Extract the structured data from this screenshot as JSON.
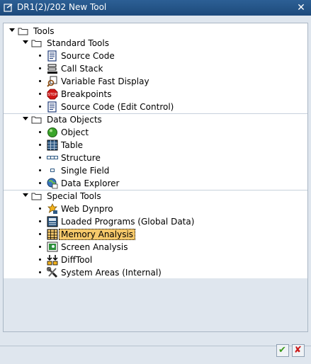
{
  "window": {
    "title": "DR1(2)/202 New Tool",
    "close_glyph": "✕"
  },
  "tree": {
    "root": {
      "label": "Tools",
      "icon": "folder-icon"
    },
    "groups": [
      {
        "label": "Standard Tools",
        "items": [
          {
            "label": "Source Code",
            "icon": "source-code-icon"
          },
          {
            "label": "Call Stack",
            "icon": "call-stack-icon"
          },
          {
            "label": "Variable Fast Display",
            "icon": "variable-display-icon"
          },
          {
            "label": "Breakpoints",
            "icon": "stop-sign-icon",
            "icon_text": "STOP"
          },
          {
            "label": "Source Code (Edit Control)",
            "icon": "source-code-edit-icon"
          }
        ]
      },
      {
        "label": "Data Objects",
        "items": [
          {
            "label": "Object",
            "icon": "object-sphere-icon"
          },
          {
            "label": "Table",
            "icon": "table-icon"
          },
          {
            "label": "Structure",
            "icon": "structure-icon"
          },
          {
            "label": "Single Field",
            "icon": "single-field-icon"
          },
          {
            "label": "Data Explorer",
            "icon": "data-explorer-icon"
          }
        ]
      },
      {
        "label": "Special Tools",
        "items": [
          {
            "label": "Web Dynpro",
            "icon": "web-dynpro-icon"
          },
          {
            "label": "Loaded Programs (Global Data)",
            "icon": "loaded-programs-icon"
          },
          {
            "label": "Memory Analysis",
            "icon": "memory-analysis-icon",
            "selected": true
          },
          {
            "label": "Screen Analysis",
            "icon": "screen-analysis-icon"
          },
          {
            "label": "DiffTool",
            "icon": "diff-tool-icon"
          },
          {
            "label": "System Areas (Internal)",
            "icon": "system-areas-icon"
          }
        ]
      }
    ]
  },
  "footer": {
    "ok_glyph": "✔",
    "cancel_glyph": "✘"
  },
  "colors": {
    "title_bar": "#1d4a7b",
    "selection": "#f7c96b",
    "ok_green": "#3a9a1a",
    "cancel_red": "#cc1a1a"
  }
}
